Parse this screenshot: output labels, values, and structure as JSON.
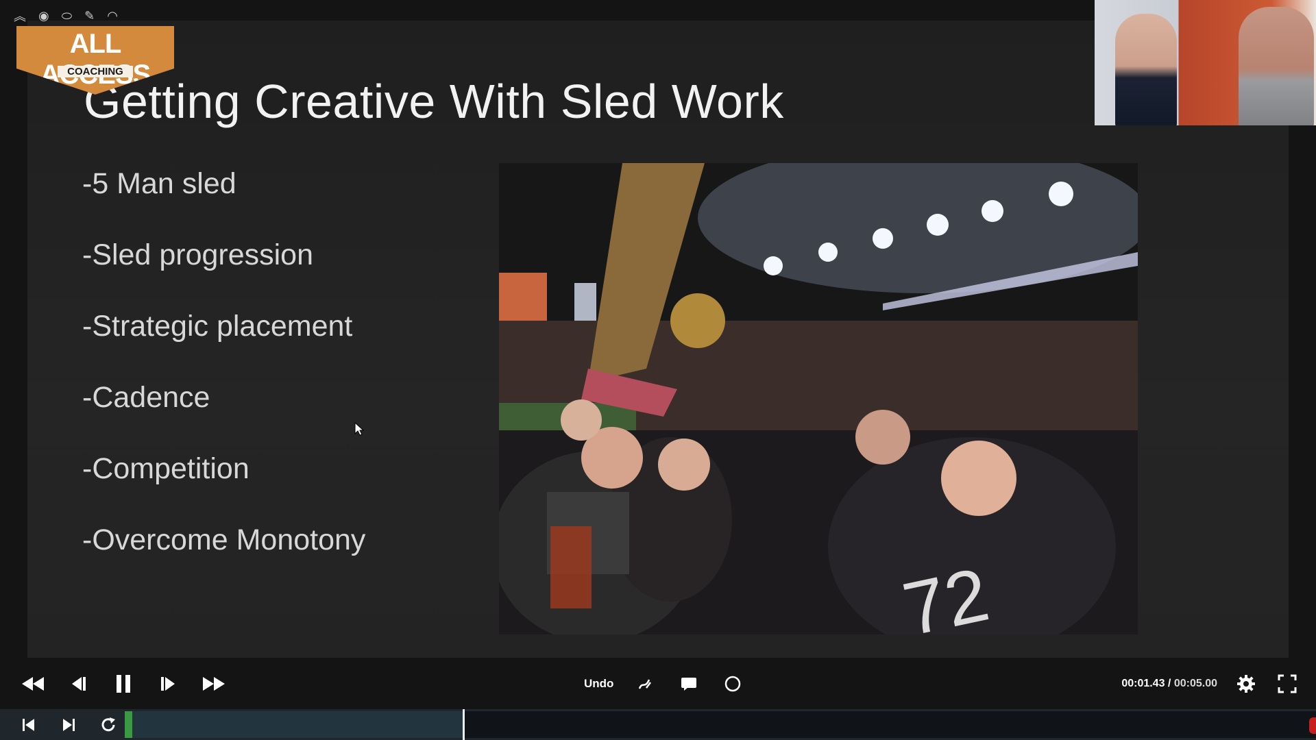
{
  "slide": {
    "title": "Getting Creative With Sled Work",
    "bullets": [
      "-5 Man sled",
      "-Sled progression",
      "-Strategic placement",
      "-Cadence",
      "-Competition",
      "-Overcome Monotony"
    ]
  },
  "logo": {
    "line1": "ALL ACCESS",
    "line2": "COACHING"
  },
  "top_icons": [
    "collapse-icon",
    "badge-icon",
    "football-icon",
    "whistle-icon",
    "helmet-icon"
  ],
  "controls": {
    "undo_label": "Undo",
    "time_current": "00:01.43",
    "time_separator": " / ",
    "time_total": "00:05.00"
  },
  "timeline": {
    "progress_fraction": 0.286
  },
  "colors": {
    "accent_green": "#3a9a42",
    "logo_orange": "#d48a3c",
    "end_marker_red": "#c81e1e"
  }
}
